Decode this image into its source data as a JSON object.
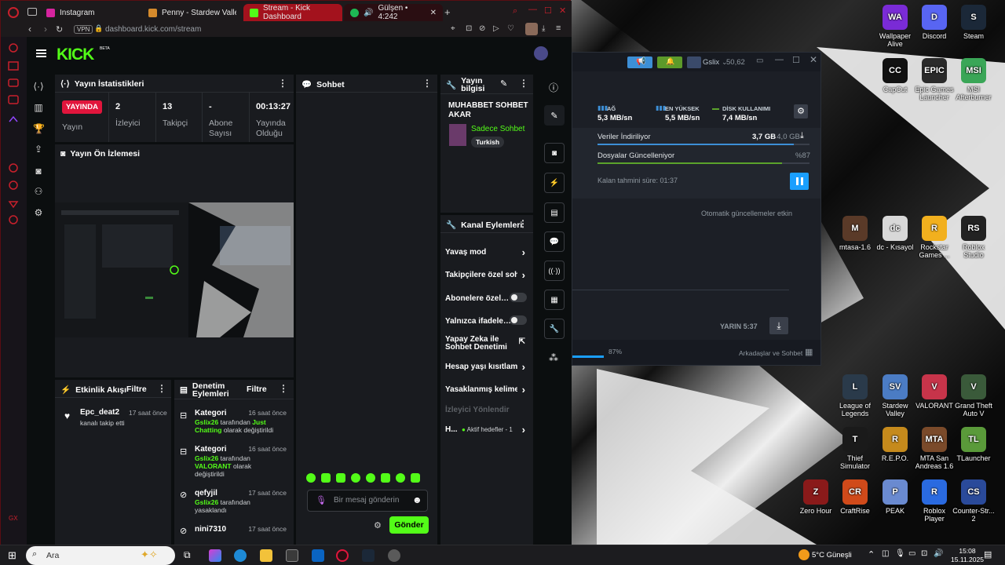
{
  "browser": {
    "tabs": [
      {
        "label": "Instagram",
        "color": "#d6249f"
      },
      {
        "label": "Penny - Stardew Valley W",
        "color": "#d48a2c"
      },
      {
        "label": "Stream - Kick Dashboard",
        "color": "#53fc18"
      },
      {
        "label": "Gülşen • 4:242",
        "color": "#1db954"
      }
    ],
    "vpn": "VPN",
    "url_host": "dashboard.kick.com",
    "url_path": "/stream"
  },
  "kick": {
    "logo": "KICK",
    "beta": "BETA",
    "stats": {
      "title": "Yayın İstatistikleri",
      "live_badge": "YAYINDA",
      "live_label": "Yayın",
      "viewers_val": "2",
      "viewers_label": "İzleyici",
      "followers_val": "13",
      "followers_label": "Takipçi",
      "subs_val": "-",
      "subs_label": "Abone Sayısı",
      "uptime_val": "00:13:27",
      "uptime_label": "Yayında Olduğu"
    },
    "preview_title": "Yayın Ön İzlemesi",
    "chat": {
      "title": "Sohbet",
      "placeholder": "Bir mesaj gönderin",
      "send": "Gönder"
    },
    "info": {
      "title": "Yayın bilgisi",
      "stream_title": "MUHABBET SOHBET AKAR",
      "category": "Sadece Sohbet",
      "language": "Turkish"
    },
    "channel": {
      "title": "Kanal Eylemleri",
      "items": [
        "Yavaş mod",
        "Takipçilere özel sohbet",
        "Abonelere özel…",
        "Yalnızca ifadele…",
        "Yapay Zeka ile Sohbet Denetimi",
        "Hesap yaşı kısıtlaması",
        "Yasaklanmış kelimeler",
        "İzleyici Yönlendir",
        "H..."
      ],
      "active_goals": "Aktif hedefler - 1"
    },
    "activity": {
      "title": "Etkinlik Akışı",
      "filter": "Filtre",
      "user": "Epc_deat2",
      "time": "17 saat önce",
      "desc": "kanalı takip etti"
    },
    "moderation": {
      "title": "Denetim Eylemleri",
      "filter": "Filtre",
      "rows": [
        {
          "user": "Kategori",
          "time": "16 saat önce",
          "actor": "Gslix26",
          "mid": "tarafından",
          "target": "Just Chatting",
          "end": "olarak değiştirildi"
        },
        {
          "user": "Kategori",
          "time": "16 saat önce",
          "actor": "Gslix26",
          "mid": "tarafından",
          "target": "VALORANT",
          "end": "olarak değiştirildi"
        },
        {
          "user": "qefyjil",
          "time": "17 saat önce",
          "actor": "Gslix26",
          "mid": "tarafından",
          "target": "",
          "end": "yasaklandı"
        },
        {
          "user": "nini7310",
          "time": "17 saat önce",
          "actor": "",
          "mid": "",
          "target": "",
          "end": ""
        }
      ]
    }
  },
  "steam": {
    "user": "Gslix",
    "balance": "50,62",
    "network_label": "AĞ",
    "network_val": "5,3 MB/sn",
    "peak_label": "EN YÜKSEK",
    "peak_val": "5,5 MB/sn",
    "disk_label": "DİSK KULLANIMI",
    "disk_val": "7,4 MB/sn",
    "downloading": "Veriler İndiriliyor",
    "dl_size": "3,7 GB",
    "dl_total": " / 4,0 GB",
    "dl_progress": 0.925,
    "updating": "Dosyalar Güncelleniyor",
    "upd_pct": "%87",
    "upd_progress": 0.87,
    "eta": "Kalan tahmini süre: 01:37",
    "auto_updates": "Otomatik güncellemeler etkin",
    "tomorrow": "YARIN 5:37",
    "footer_pct": "87%",
    "friends": "Arkadaşlar ve Sohbet"
  },
  "desktop_icons": [
    {
      "label": "Wallpaper Alive",
      "color": "#7a2bd6",
      "glyph": "WA"
    },
    {
      "label": "Discord",
      "color": "#5865f2",
      "glyph": "D"
    },
    {
      "label": "Steam",
      "color": "#1b2838",
      "glyph": "S"
    },
    {
      "label": "CapCut",
      "color": "#111111",
      "glyph": "CC"
    },
    {
      "label": "Epic Games Launcher",
      "color": "#2a2a2a",
      "glyph": "EPIC"
    },
    {
      "label": "MSI Afterburner",
      "color": "#3aa657",
      "glyph": "MSI"
    },
    {
      "label": "mtasa-1.6",
      "color": "#5a3a28",
      "glyph": "M"
    },
    {
      "label": "dc - Kısayol",
      "color": "#d8d8d8",
      "glyph": "dc"
    },
    {
      "label": "Rockstar Games ...",
      "color": "#f2b01e",
      "glyph": "R"
    },
    {
      "label": "Roblox Studio",
      "color": "#222222",
      "glyph": "RS"
    },
    {
      "label": "League of Legends",
      "color": "#2a3a4a",
      "glyph": "L"
    },
    {
      "label": "Stardew Valley",
      "color": "#4b7cc4",
      "glyph": "SV"
    },
    {
      "label": "VALORANT",
      "color": "#c7344a",
      "glyph": "V"
    },
    {
      "label": "Grand Theft Auto V",
      "color": "#3a5a3a",
      "glyph": "V"
    },
    {
      "label": "Thief Simulator",
      "color": "#1a1a1a",
      "glyph": "T"
    },
    {
      "label": "R.E.P.O.",
      "color": "#c58a1c",
      "glyph": "R"
    },
    {
      "label": "MTA San Andreas 1.6",
      "color": "#7a4a2a",
      "glyph": "MTA"
    },
    {
      "label": "TLauncher",
      "color": "#5a9a3a",
      "glyph": "TL"
    },
    {
      "label": "Zero Hour",
      "color": "#8a1a1a",
      "glyph": "Z"
    },
    {
      "label": "CraftRise",
      "color": "#d04a1a",
      "glyph": "CR"
    },
    {
      "label": "PEAK",
      "color": "#6a8ad0",
      "glyph": "P"
    },
    {
      "label": "Roblox Player",
      "color": "#2a6ae0",
      "glyph": "R"
    },
    {
      "label": "Counter-Str... 2",
      "color": "#2a4a9a",
      "glyph": "CS"
    }
  ],
  "taskbar": {
    "search": "Ara",
    "weather": "5°C  Güneşli",
    "time": "15:08",
    "date": "15.11.2025"
  }
}
